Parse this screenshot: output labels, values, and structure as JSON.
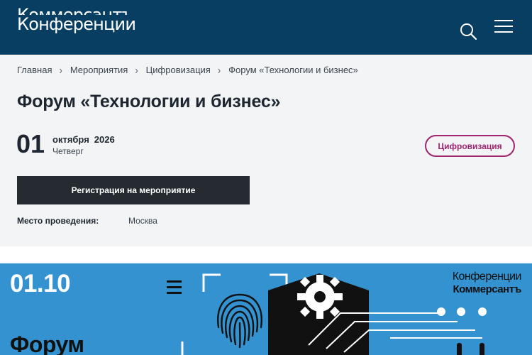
{
  "header": {
    "logo_line1": "Коммерсантъ",
    "logo_line2": "Конференции",
    "search_icon": "search-icon",
    "menu_icon": "hamburger-menu-icon"
  },
  "breadcrumb": {
    "items": [
      "Главная",
      "Мероприятия",
      "Цифровизация",
      "Форум «Технологии и бизнес»"
    ],
    "separator": "chevron-right-icon"
  },
  "event": {
    "title": "Форум «Технологии и бизнес»",
    "day": "01",
    "month": "октября",
    "year": "2026",
    "weekday": "Четверг",
    "tag": "Цифровизация",
    "register_label": "Регистрация на мероприятие",
    "venue_label": "Место проведения:",
    "venue_value": "Москва"
  },
  "banner": {
    "date": "01.10",
    "title": "Форум",
    "logo_line1": "Конференции",
    "logo_line2": "Коммерсантъ"
  },
  "colors": {
    "header_bg": "#083e62",
    "panel_bg": "#f2f4f5",
    "tag_accent": "#a0246f",
    "button_bg": "#252b31",
    "banner_bg": "#3392cf"
  }
}
